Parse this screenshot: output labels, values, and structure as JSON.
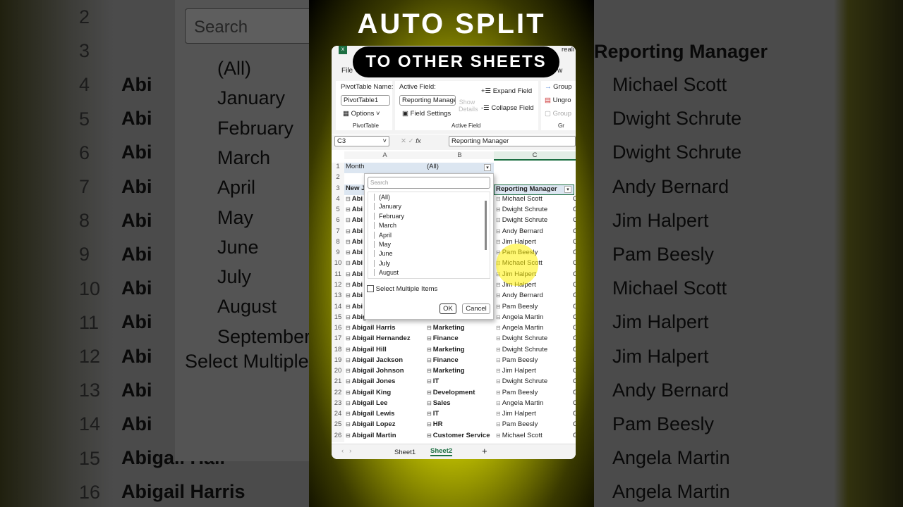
{
  "overlay": {
    "title": "AUTO SPLIT",
    "subtitle": "TO OTHER SHEETS"
  },
  "app": {
    "file_menu": "File",
    "title_fragment": "reali",
    "view_fragment": "w"
  },
  "ribbon": {
    "pivottable_name_label": "PivotTable Name:",
    "pivottable_name_value": "PivotTable1",
    "options_button": "Options",
    "pivottable_group": "PivotTable",
    "active_field_label": "Active Field:",
    "active_field_value": "Reporting Manage",
    "field_settings_button": "Field Settings",
    "show_details_button": "Show Details",
    "expand_field_button": "Expand Field",
    "collapse_field_button": "Collapse Field",
    "active_field_group": "Active Field",
    "group_button": "Group",
    "ungroup_button": "Ungro",
    "group_field_button": "Group",
    "group3_label": "Gr"
  },
  "formula_bar": {
    "name_box": "C3",
    "fx": "fx",
    "formula": "Reporting Manager"
  },
  "columns": [
    "A",
    "B",
    "C"
  ],
  "filter": {
    "label": "Month",
    "value": "(All)"
  },
  "headers": {
    "a": "New J",
    "c": "Reporting Manager"
  },
  "rows": [
    {
      "n": 4,
      "a": "Abi",
      "b": "",
      "c": "Michael Scott"
    },
    {
      "n": 5,
      "a": "Abi",
      "b": "",
      "c": "Dwight Schrute"
    },
    {
      "n": 6,
      "a": "Abi",
      "b": "",
      "c": "Dwight Schrute"
    },
    {
      "n": 7,
      "a": "Abi",
      "b": "",
      "c": "Andy Bernard"
    },
    {
      "n": 8,
      "a": "Abi",
      "b": "",
      "c": "Jim Halpert"
    },
    {
      "n": 9,
      "a": "Abi",
      "b": "",
      "c": "Pam Beesly"
    },
    {
      "n": 10,
      "a": "Abi",
      "b": "",
      "c": "Michael Scott"
    },
    {
      "n": 11,
      "a": "Abi",
      "b": "",
      "c": "Jim Halpert"
    },
    {
      "n": 12,
      "a": "Abi",
      "b": "",
      "c": "Jim Halpert"
    },
    {
      "n": 13,
      "a": "Abi",
      "b": "",
      "c": "Andy Bernard"
    },
    {
      "n": 14,
      "a": "Abi",
      "b": "",
      "c": "Pam Beesly"
    },
    {
      "n": 15,
      "a": "Abigail Hall",
      "b": "Finance",
      "c": "Angela Martin"
    },
    {
      "n": 16,
      "a": "Abigail Harris",
      "b": "Marketing",
      "c": "Angela Martin"
    },
    {
      "n": 17,
      "a": "Abigail Hernandez",
      "b": "Finance",
      "c": "Dwight Schrute"
    },
    {
      "n": 18,
      "a": "Abigail Hill",
      "b": "Marketing",
      "c": "Dwight Schrute"
    },
    {
      "n": 19,
      "a": "Abigail Jackson",
      "b": "Finance",
      "c": "Pam Beesly"
    },
    {
      "n": 20,
      "a": "Abigail Johnson",
      "b": "Marketing",
      "c": "Jim Halpert"
    },
    {
      "n": 21,
      "a": "Abigail Jones",
      "b": "IT",
      "c": "Dwight Schrute"
    },
    {
      "n": 22,
      "a": "Abigail King",
      "b": "Development",
      "c": "Pam Beesly"
    },
    {
      "n": 23,
      "a": "Abigail Lee",
      "b": "Sales",
      "c": "Angela Martin"
    },
    {
      "n": 24,
      "a": "Abigail Lewis",
      "b": "IT",
      "c": "Jim Halpert"
    },
    {
      "n": 25,
      "a": "Abigail Lopez",
      "b": "HR",
      "c": "Pam Beesly"
    },
    {
      "n": 26,
      "a": "Abigail Martin",
      "b": "Customer Service",
      "c": "Michael Scott"
    }
  ],
  "dropdown": {
    "search_placeholder": "Search",
    "items": [
      "(All)",
      "January",
      "February",
      "March",
      "April",
      "May",
      "June",
      "July",
      "August",
      "September"
    ],
    "select_multiple": "Select Multiple Items",
    "ok": "OK",
    "cancel": "Cancel"
  },
  "sheets": {
    "tabs": [
      "Sheet1",
      "Sheet2"
    ],
    "active": "Sheet2",
    "add": "+"
  }
}
